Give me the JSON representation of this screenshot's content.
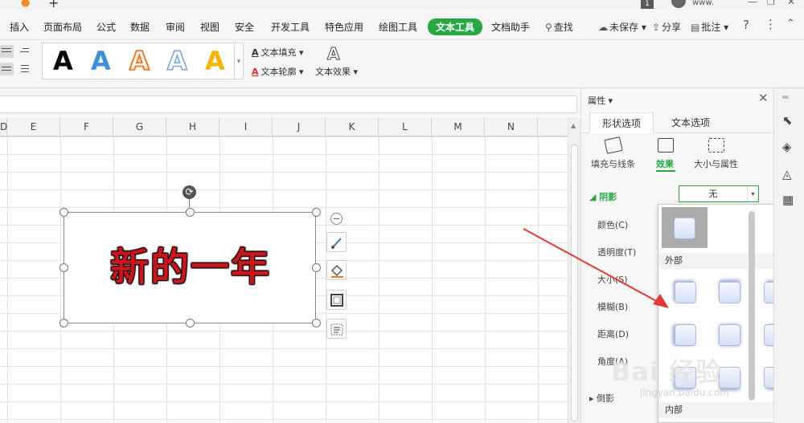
{
  "titlebar": {
    "counter": "1",
    "user": "www."
  },
  "menu": {
    "tabs": [
      "插入",
      "页面布局",
      "公式",
      "数据",
      "审阅",
      "视图",
      "安全",
      "开发工具",
      "特色应用",
      "绘图工具",
      "文本工具",
      "文档助手"
    ],
    "active_tab": "文本工具",
    "search": "查找",
    "unsaved": "未保存",
    "share": "分享",
    "annotate": "批注",
    "help": "?",
    "more": "⋮"
  },
  "ribbon": {
    "gallery_letter": "A",
    "text_fill": "文本填充",
    "text_outline": "文本轮廓",
    "text_effect": "文本效果",
    "gallery_colors": [
      "#000000",
      "#3b8fdb",
      "#f07a26",
      "#7aa3d8",
      "#f5b400"
    ]
  },
  "columns": [
    "D",
    "E",
    "F",
    "G",
    "H",
    "I",
    "J",
    "K",
    "L",
    "M",
    "N"
  ],
  "textbox": {
    "content": "新的一年",
    "text_color": "#c8161d"
  },
  "pane": {
    "title": "属性",
    "tabs": [
      "形状选项",
      "文本选项"
    ],
    "sub_tabs": [
      "填充与线条",
      "效果",
      "大小与属性"
    ],
    "active_sub_tab": "效果",
    "section": "阴影",
    "shadow_value": "无",
    "props": [
      "颜色(C)",
      "透明度(T)",
      "大小(S)",
      "模糊(B)",
      "距离(D)",
      "角度(A)"
    ],
    "next_section": "倒影"
  },
  "shadow_dropdown": {
    "sections": [
      "外部",
      "内部"
    ]
  },
  "watermark": {
    "brand": "Bai 经验",
    "url": "jingyan.baidu.com"
  },
  "colors": {
    "accent": "#27a845",
    "arrow": "#e53935"
  }
}
